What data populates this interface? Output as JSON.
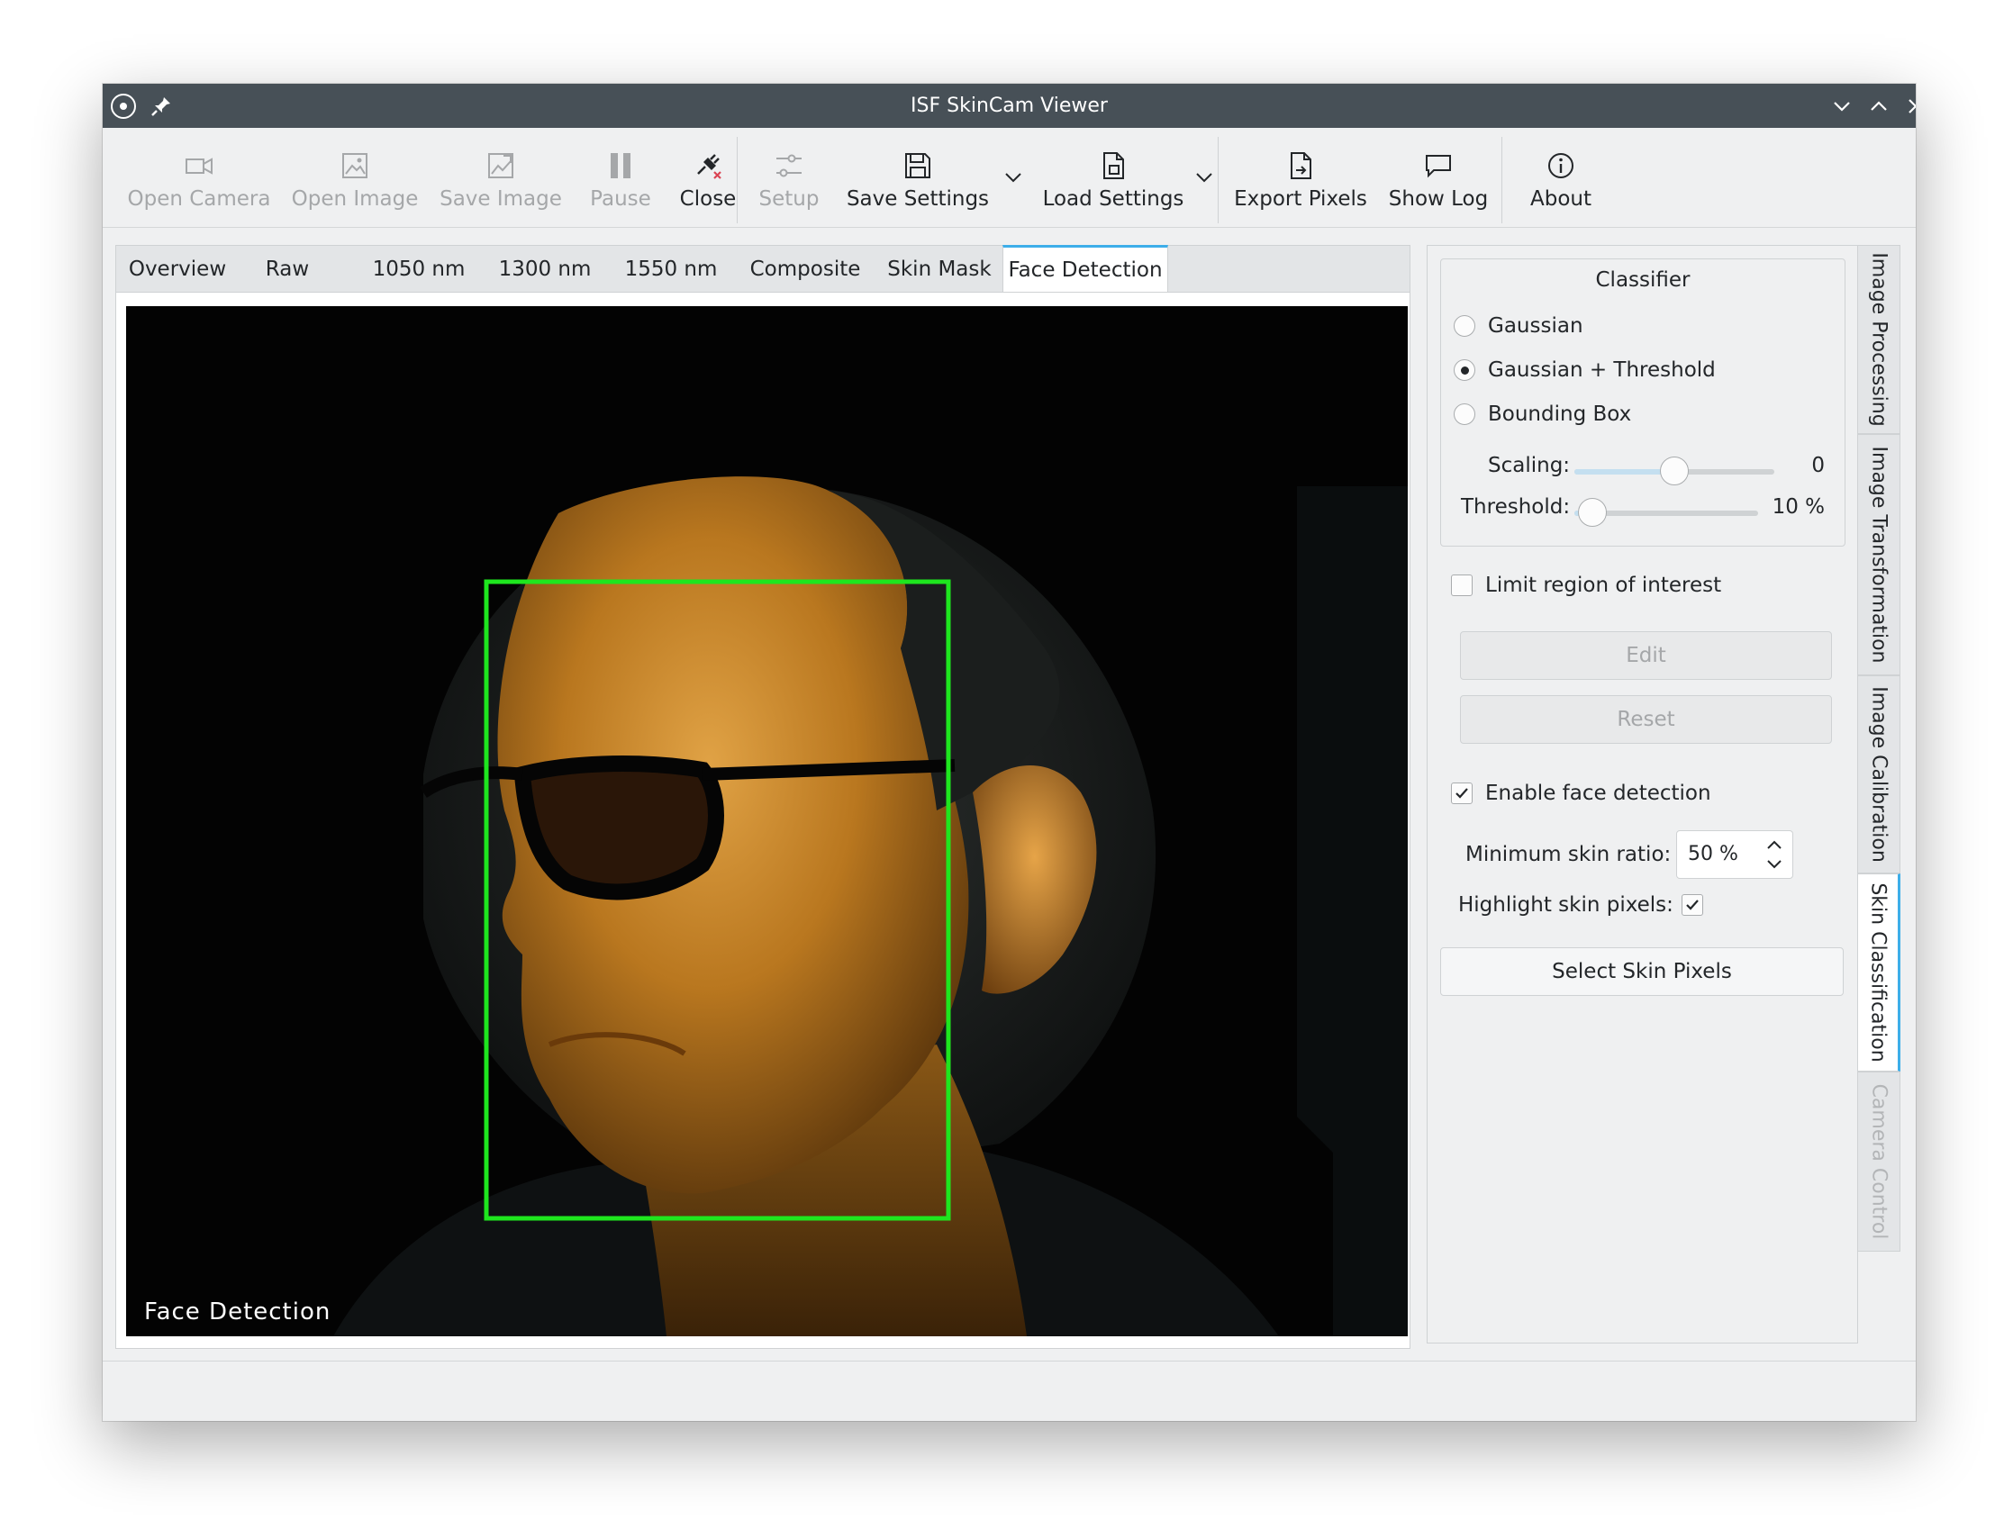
{
  "window": {
    "title": "ISF SkinCam Viewer"
  },
  "toolbar": {
    "open_camera": "Open Camera",
    "open_image": "Open Image",
    "save_image": "Save Image",
    "pause": "Pause",
    "close": "Close",
    "setup": "Setup",
    "save_settings": "Save Settings",
    "load_settings": "Load Settings",
    "export_pixels": "Export Pixels",
    "show_log": "Show Log",
    "about": "About"
  },
  "tabs": [
    "Overview",
    "Raw",
    "1050 nm",
    "1300 nm",
    "1550 nm",
    "Composite",
    "Skin Mask",
    "Face Detection"
  ],
  "active_tab": "Face Detection",
  "viewer": {
    "caption": "Face Detection",
    "bounding_box_color": "#1ee61e"
  },
  "classifier": {
    "title": "Classifier",
    "options": [
      "Gaussian",
      "Gaussian + Threshold",
      "Bounding Box"
    ],
    "selected": "Gaussian + Threshold",
    "scaling_label": "Scaling:",
    "scaling_value": "0",
    "scaling_fraction": 0.5,
    "threshold_label": "Threshold:",
    "threshold_value": "10 %",
    "threshold_fraction": 0.1
  },
  "roi": {
    "label": "Limit region of interest",
    "checked": false,
    "edit_label": "Edit",
    "reset_label": "Reset"
  },
  "face_detection": {
    "enable_label": "Enable face detection",
    "enabled": true,
    "min_ratio_label": "Minimum skin ratio:",
    "min_ratio_value": "50 %",
    "highlight_label": "Highlight skin pixels:",
    "highlight_checked": true,
    "select_button": "Select Skin Pixels"
  },
  "side_tabs": [
    "Image Processing",
    "Image Transformation",
    "Image Calibration",
    "Skin Classification",
    "Camera Control"
  ],
  "active_side_tab": "Skin Classification",
  "colors": {
    "accent": "#3daee9",
    "titlebar": "#475057"
  }
}
